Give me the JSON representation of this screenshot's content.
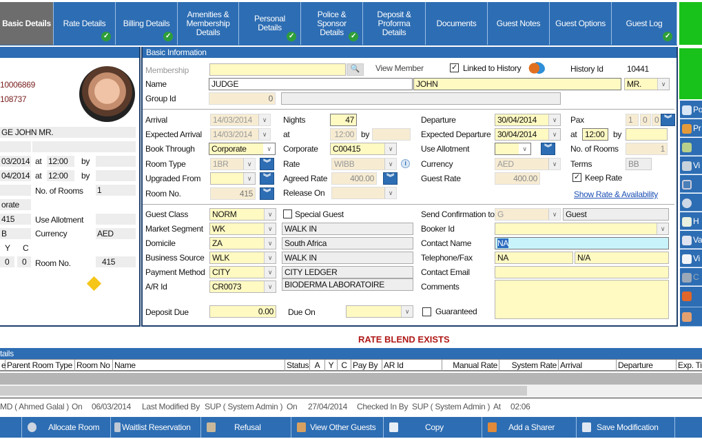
{
  "tabs": [
    {
      "label": "Basic Details",
      "checked": false
    },
    {
      "label": "Rate Details",
      "checked": true
    },
    {
      "label": "Billing Details",
      "checked": true
    },
    {
      "label": "Amenities & Membership Details",
      "checked": false
    },
    {
      "label": "Personal Details",
      "checked": true
    },
    {
      "label": "Police & Sponsor Details",
      "checked": true
    },
    {
      "label": "Deposit & Proforma Details",
      "checked": false
    },
    {
      "label": "Documents",
      "checked": false
    },
    {
      "label": "Guest Notes",
      "checked": false
    },
    {
      "label": "Guest Options",
      "checked": false
    },
    {
      "label": "Guest Log",
      "checked": true
    }
  ],
  "summary": {
    "res_no": "10006869",
    "guest_no": "108737",
    "name": "GE JOHN MR.",
    "arrival": "03/2014",
    "arrival_at": "at",
    "arrival_time": "12:00",
    "arrival_by": "by",
    "departure": "04/2014",
    "departure_at": "at",
    "departure_time": "12:00",
    "departure_by": "by",
    "rooms_label": "No. of Rooms",
    "rooms": "1",
    "book_through": "orate",
    "room_no_short": "415",
    "allotment_label": "Use Allotment",
    "rate_short": "B",
    "currency_label": "Currency",
    "currency": "AED",
    "y_label": "Y",
    "c_label": "C",
    "y": "0",
    "c": "0",
    "room_no_label": "Room No.",
    "room_no": "415"
  },
  "basic": {
    "title": "Basic Information",
    "membership_label": "Membership",
    "membership": "",
    "view_member": "View Member",
    "linked_label": "Linked to History",
    "linked": true,
    "history_id_label": "History Id",
    "history_id": "10441",
    "name_label": "Name",
    "last_name": "JUDGE",
    "first_name": "JOHN",
    "title_value": "MR.",
    "group_label": "Group Id",
    "group_id": "0",
    "group_desc": "",
    "arrival_label": "Arrival",
    "arrival": "14/03/2014",
    "exp_arrival_label": "Expected Arrival",
    "exp_arrival": "14/03/2014",
    "book_through_label": "Book Through",
    "book_through": "Corporate",
    "room_type_label": "Room Type",
    "room_type": "1BR",
    "upgraded_label": "Upgraded From",
    "upgraded": "",
    "room_no_label": "Room No.",
    "room_no": "415",
    "nights_label": "Nights",
    "nights": "47",
    "at_label": "at",
    "arr_time": "12:00",
    "by_label": "by",
    "arr_by": "",
    "corporate_label": "Corporate",
    "corporate": "C00415",
    "rate_label": "Rate",
    "rate": "WIBB",
    "agreed_rate_label": "Agreed Rate",
    "agreed_rate": "400.00",
    "release_label": "Release On",
    "release": "",
    "departure_label": "Departure",
    "departure": "30/04/2014",
    "exp_departure_label": "Expected Departure",
    "exp_departure": "30/04/2014",
    "allotment_label": "Use Allotment",
    "allotment": "",
    "currency_label": "Currency",
    "currency": "AED",
    "guest_rate_label": "Guest Rate",
    "guest_rate": "400.00",
    "pax_label": "Pax",
    "pax_a": "1",
    "pax_y": "0",
    "pax_c": "0",
    "dep_time": "12:00",
    "dep_by": "",
    "rooms_label": "No. of Rooms",
    "rooms": "1",
    "terms_label": "Terms",
    "terms": "BB",
    "keep_rate_label": "Keep Rate",
    "keep_rate": true,
    "show_rate_link": "Show Rate & Availability",
    "guest_class_label": "Guest Class",
    "guest_class": "NORM",
    "special_label": "Special Guest",
    "special": false,
    "market_label": "Market Segment",
    "market": "WK",
    "market_desc": "WALK IN",
    "domicile_label": "Domicile",
    "domicile": "ZA",
    "domicile_desc": "South Africa",
    "source_label": "Business Source",
    "source": "WLK",
    "source_desc": "WALK IN",
    "payment_label": "Payment Method",
    "payment": "CITY",
    "payment_desc": "CITY LEDGER",
    "ar_label": "A/R Id",
    "ar": "CR0073",
    "ar_desc": "BIODERMA LABORATOIRE",
    "deposit_label": "Deposit Due",
    "deposit": "0.00",
    "due_on_label": "Due On",
    "due_on": "",
    "guaranteed_label": "Guaranteed",
    "guaranteed": false,
    "send_conf_label": "Send Confirmation to",
    "send_conf": "G",
    "send_conf_desc": "Guest",
    "booker_label": "Booker Id",
    "booker": "",
    "contact_name_label": "Contact Name",
    "contact_name": "NA",
    "tel_label": "Telephone/Fax",
    "tel": "NA",
    "fax": "N/A",
    "email_label": "Contact Email",
    "email": "",
    "comments_label": "Comments",
    "comments": ""
  },
  "side": [
    "Po",
    "Pr",
    "",
    "Vi",
    "",
    "",
    "H",
    "Va",
    "Vi",
    "C",
    "",
    ""
  ],
  "rate_blend": "RATE BLEND EXISTS",
  "details": {
    "title": "tails",
    "columns": [
      "e",
      "Parent Room Type",
      "Room No",
      "Name",
      "Status",
      "A",
      "Y",
      "C",
      "Pay By",
      "AR Id",
      "Manual Rate",
      "System Rate",
      "Arrival",
      "Departure",
      "Exp. Ti"
    ]
  },
  "status": {
    "created_by": "MD ( Ahmed Galal )",
    "on1": "On",
    "created_on": "06/03/2014",
    "modified_label": "Last Modified By",
    "modified_by": "SUP ( System Admin )",
    "on2": "On",
    "modified_on": "27/04/2014",
    "checked_label": "Checked In By",
    "checked_by": "SUP ( System Admin )",
    "at": "At",
    "checked_at": "02:06"
  },
  "actions": [
    "Allocate Room",
    "Waitlist Reservation",
    "Refusal",
    "View Other Guests",
    "Copy",
    "Add a Sharer",
    "Save  Modification"
  ],
  "colors": {
    "accent": "#2d6db3",
    "green": "#19c21a",
    "field": "#fff9c2",
    "alert": "#b01818"
  }
}
